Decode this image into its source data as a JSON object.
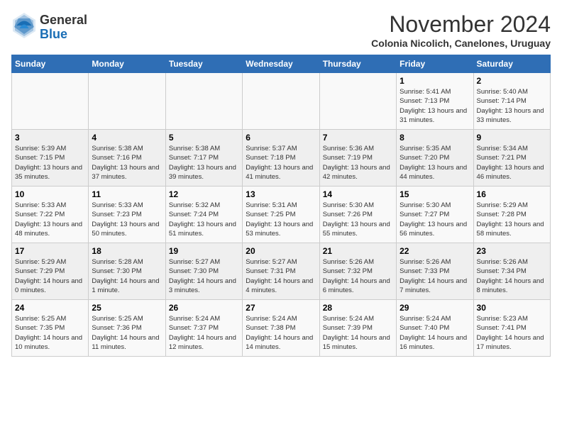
{
  "header": {
    "logo_general": "General",
    "logo_blue": "Blue",
    "month_title": "November 2024",
    "subtitle": "Colonia Nicolich, Canelones, Uruguay"
  },
  "days_of_week": [
    "Sunday",
    "Monday",
    "Tuesday",
    "Wednesday",
    "Thursday",
    "Friday",
    "Saturday"
  ],
  "weeks": [
    [
      {
        "day": "",
        "info": ""
      },
      {
        "day": "",
        "info": ""
      },
      {
        "day": "",
        "info": ""
      },
      {
        "day": "",
        "info": ""
      },
      {
        "day": "",
        "info": ""
      },
      {
        "day": "1",
        "info": "Sunrise: 5:41 AM\nSunset: 7:13 PM\nDaylight: 13 hours and 31 minutes."
      },
      {
        "day": "2",
        "info": "Sunrise: 5:40 AM\nSunset: 7:14 PM\nDaylight: 13 hours and 33 minutes."
      }
    ],
    [
      {
        "day": "3",
        "info": "Sunrise: 5:39 AM\nSunset: 7:15 PM\nDaylight: 13 hours and 35 minutes."
      },
      {
        "day": "4",
        "info": "Sunrise: 5:38 AM\nSunset: 7:16 PM\nDaylight: 13 hours and 37 minutes."
      },
      {
        "day": "5",
        "info": "Sunrise: 5:38 AM\nSunset: 7:17 PM\nDaylight: 13 hours and 39 minutes."
      },
      {
        "day": "6",
        "info": "Sunrise: 5:37 AM\nSunset: 7:18 PM\nDaylight: 13 hours and 41 minutes."
      },
      {
        "day": "7",
        "info": "Sunrise: 5:36 AM\nSunset: 7:19 PM\nDaylight: 13 hours and 42 minutes."
      },
      {
        "day": "8",
        "info": "Sunrise: 5:35 AM\nSunset: 7:20 PM\nDaylight: 13 hours and 44 minutes."
      },
      {
        "day": "9",
        "info": "Sunrise: 5:34 AM\nSunset: 7:21 PM\nDaylight: 13 hours and 46 minutes."
      }
    ],
    [
      {
        "day": "10",
        "info": "Sunrise: 5:33 AM\nSunset: 7:22 PM\nDaylight: 13 hours and 48 minutes."
      },
      {
        "day": "11",
        "info": "Sunrise: 5:33 AM\nSunset: 7:23 PM\nDaylight: 13 hours and 50 minutes."
      },
      {
        "day": "12",
        "info": "Sunrise: 5:32 AM\nSunset: 7:24 PM\nDaylight: 13 hours and 51 minutes."
      },
      {
        "day": "13",
        "info": "Sunrise: 5:31 AM\nSunset: 7:25 PM\nDaylight: 13 hours and 53 minutes."
      },
      {
        "day": "14",
        "info": "Sunrise: 5:30 AM\nSunset: 7:26 PM\nDaylight: 13 hours and 55 minutes."
      },
      {
        "day": "15",
        "info": "Sunrise: 5:30 AM\nSunset: 7:27 PM\nDaylight: 13 hours and 56 minutes."
      },
      {
        "day": "16",
        "info": "Sunrise: 5:29 AM\nSunset: 7:28 PM\nDaylight: 13 hours and 58 minutes."
      }
    ],
    [
      {
        "day": "17",
        "info": "Sunrise: 5:29 AM\nSunset: 7:29 PM\nDaylight: 14 hours and 0 minutes."
      },
      {
        "day": "18",
        "info": "Sunrise: 5:28 AM\nSunset: 7:30 PM\nDaylight: 14 hours and 1 minute."
      },
      {
        "day": "19",
        "info": "Sunrise: 5:27 AM\nSunset: 7:30 PM\nDaylight: 14 hours and 3 minutes."
      },
      {
        "day": "20",
        "info": "Sunrise: 5:27 AM\nSunset: 7:31 PM\nDaylight: 14 hours and 4 minutes."
      },
      {
        "day": "21",
        "info": "Sunrise: 5:26 AM\nSunset: 7:32 PM\nDaylight: 14 hours and 6 minutes."
      },
      {
        "day": "22",
        "info": "Sunrise: 5:26 AM\nSunset: 7:33 PM\nDaylight: 14 hours and 7 minutes."
      },
      {
        "day": "23",
        "info": "Sunrise: 5:26 AM\nSunset: 7:34 PM\nDaylight: 14 hours and 8 minutes."
      }
    ],
    [
      {
        "day": "24",
        "info": "Sunrise: 5:25 AM\nSunset: 7:35 PM\nDaylight: 14 hours and 10 minutes."
      },
      {
        "day": "25",
        "info": "Sunrise: 5:25 AM\nSunset: 7:36 PM\nDaylight: 14 hours and 11 minutes."
      },
      {
        "day": "26",
        "info": "Sunrise: 5:24 AM\nSunset: 7:37 PM\nDaylight: 14 hours and 12 minutes."
      },
      {
        "day": "27",
        "info": "Sunrise: 5:24 AM\nSunset: 7:38 PM\nDaylight: 14 hours and 14 minutes."
      },
      {
        "day": "28",
        "info": "Sunrise: 5:24 AM\nSunset: 7:39 PM\nDaylight: 14 hours and 15 minutes."
      },
      {
        "day": "29",
        "info": "Sunrise: 5:24 AM\nSunset: 7:40 PM\nDaylight: 14 hours and 16 minutes."
      },
      {
        "day": "30",
        "info": "Sunrise: 5:23 AM\nSunset: 7:41 PM\nDaylight: 14 hours and 17 minutes."
      }
    ]
  ]
}
